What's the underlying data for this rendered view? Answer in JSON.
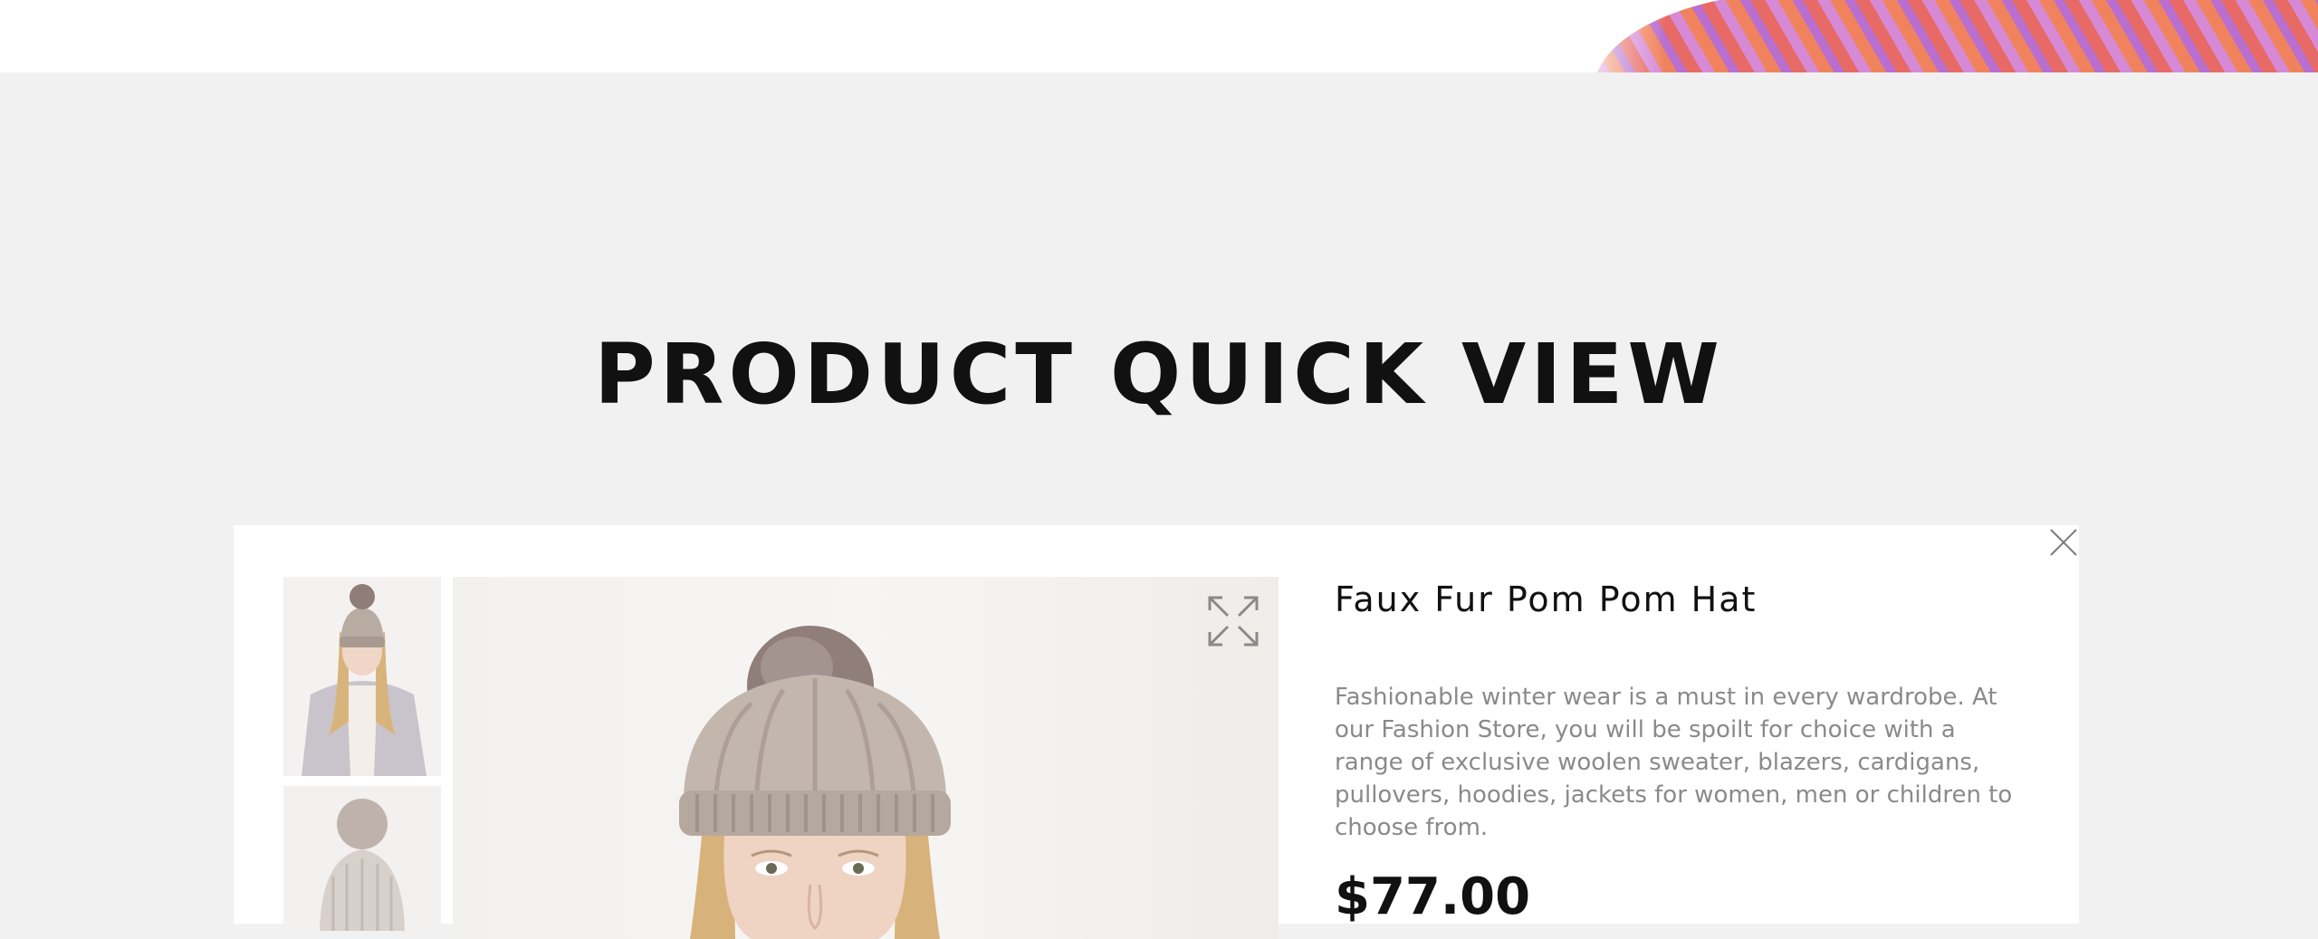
{
  "header": {
    "banner_image": "knit-texture-banner"
  },
  "section": {
    "title": "PRODUCT QUICK VIEW"
  },
  "quick_view": {
    "product_name": "Faux Fur Pom Pom Hat",
    "description": "Fashionable winter wear is a must in every wardrobe. At our Fashion Store, you will be spoilt for choice with a range of exclusive woolen sweater, blazers, cardigans, pullovers, hoodies, jackets for women, men or children to choose from.",
    "price": "$77.00",
    "close_icon": "close-icon",
    "expand_icon": "expand-icon",
    "thumbnails": [
      "model-wearing-hat",
      "hat-product-shot"
    ]
  },
  "colors": {
    "background": "#f1f1f1",
    "panel": "#ffffff",
    "title_text": "#111111",
    "description_text": "#8a8a8a"
  }
}
